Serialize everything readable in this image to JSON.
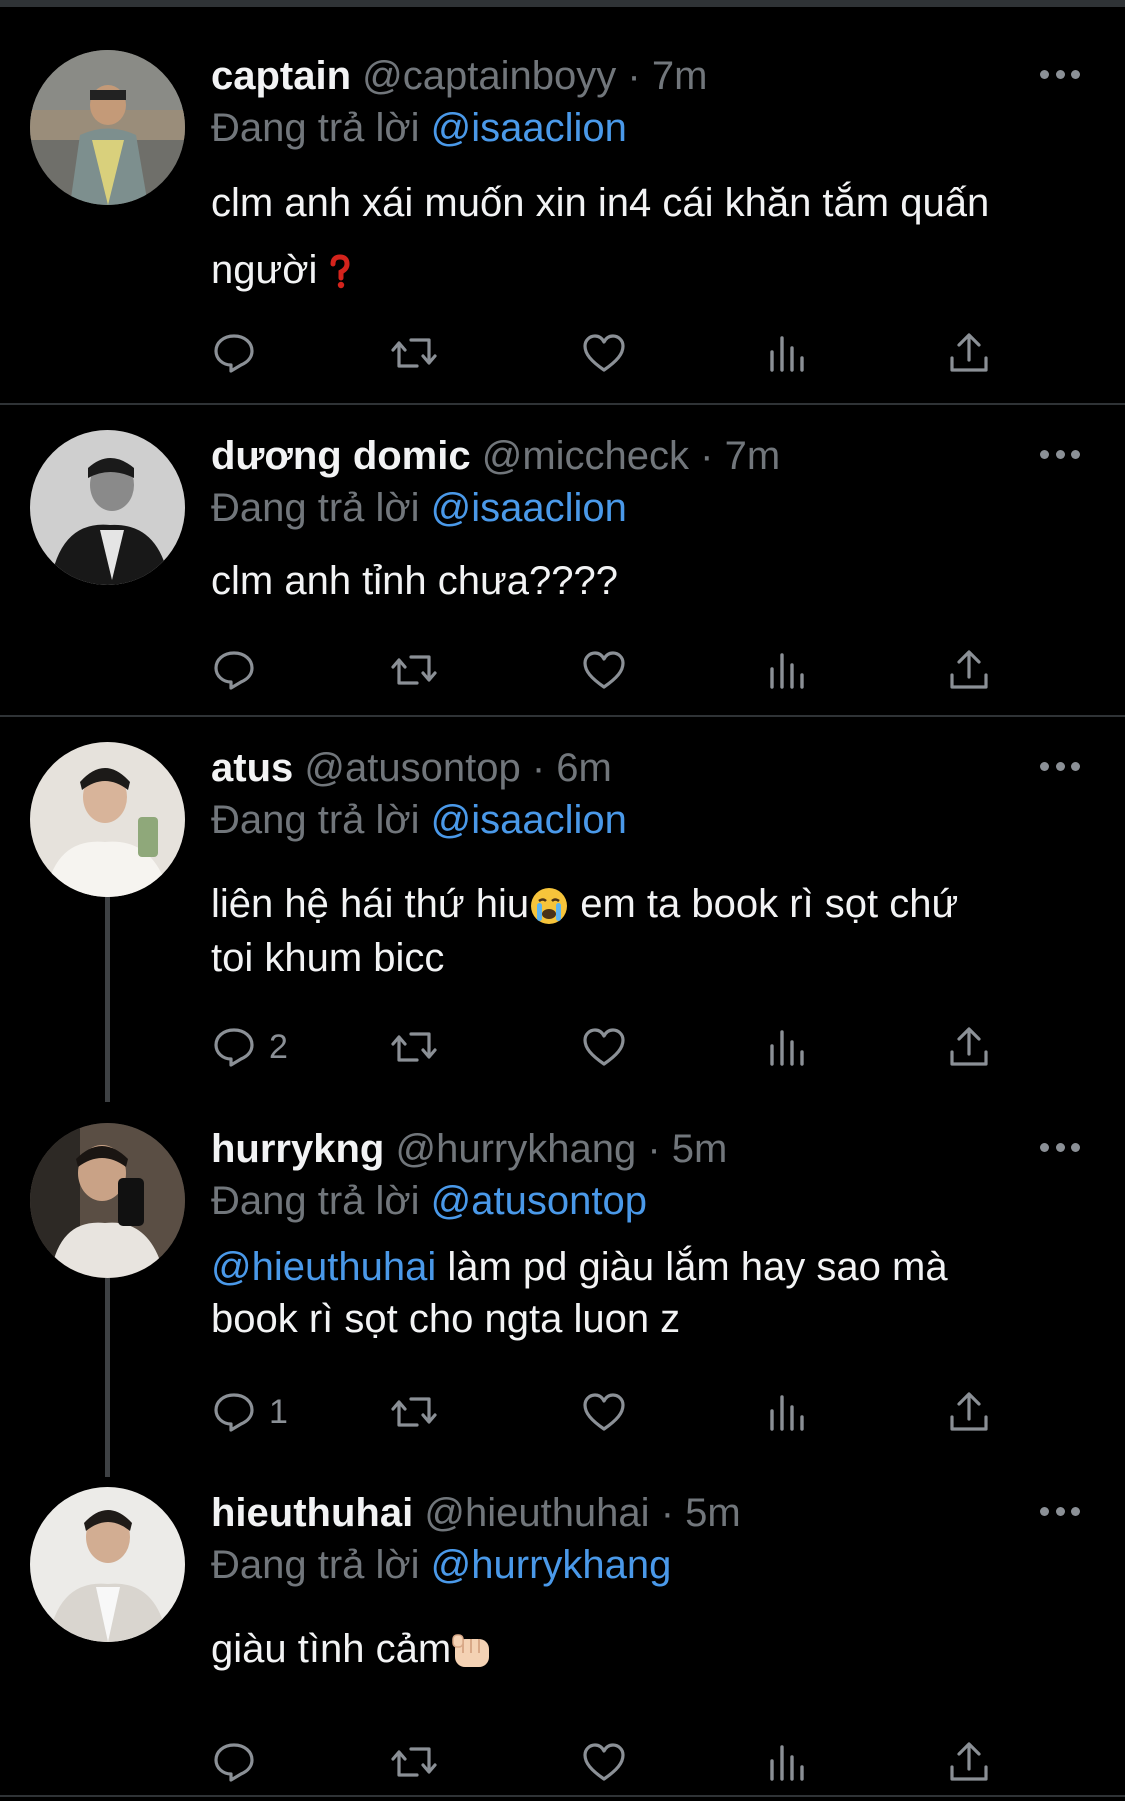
{
  "replying_label": "Đang trả lời",
  "colors": {
    "background": "#000000",
    "mention": "#4a99e9",
    "muted": "#71767b",
    "divider": "#2f3336"
  },
  "icons": [
    "reply-icon",
    "retweet-icon",
    "like-icon",
    "views-icon",
    "share-icon",
    "more-icon"
  ],
  "tweets": [
    {
      "name": "captain",
      "handle": "@captainboyy",
      "time": "7m",
      "replying_to": "@isaaclion",
      "body_line1": "clm anh xái muốn xin in4 cái khăn tắm quấn",
      "body_line2": "người",
      "emoji": "red-question-mark",
      "reply_count": ""
    },
    {
      "name": "dương domic",
      "handle": "@miccheck",
      "time": "7m",
      "replying_to": "@isaaclion",
      "body_line1": "clm anh tỉnh chưa????",
      "reply_count": ""
    },
    {
      "name": "atus",
      "handle": "@atusontop",
      "time": "6m",
      "replying_to": "@isaaclion",
      "body_line1a": "liên hệ hái thứ hiu",
      "emoji": "crying-face",
      "body_line1b": " em ta book rì sọt chứ",
      "body_line2": "toi khum bicc",
      "reply_count": "2"
    },
    {
      "name": "hurrykng",
      "handle": "@hurrykhang",
      "time": "5m",
      "replying_to": "@atusontop",
      "body_mention": "@hieuthuhai",
      "body_line1": " làm pd giàu lắm hay sao mà",
      "body_line2": "book rì sọt cho ngta luon z",
      "reply_count": "1"
    },
    {
      "name": "hieuthuhai",
      "handle": "@hieuthuhai",
      "time": "5m",
      "replying_to": "@hurrykhang",
      "body_line1": "giàu tình cảm",
      "emoji": "oncoming-fist",
      "reply_count": ""
    }
  ]
}
